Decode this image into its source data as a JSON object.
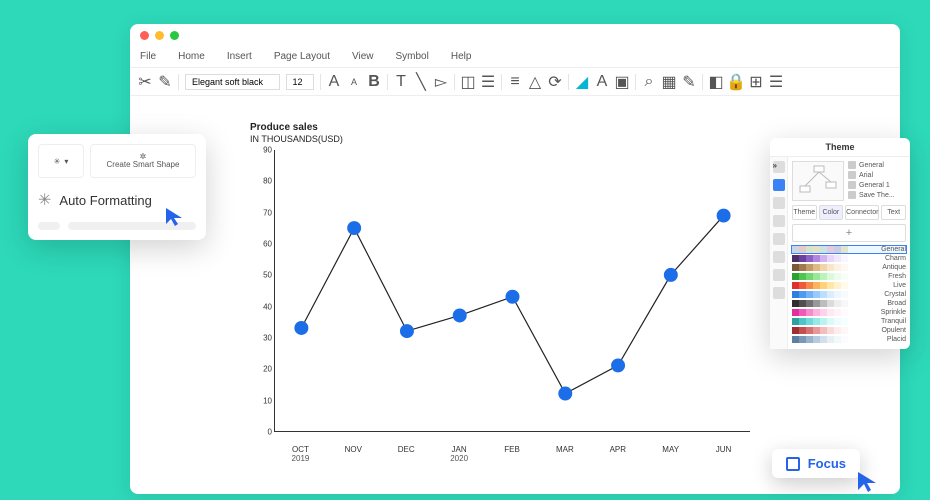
{
  "menubar": [
    "File",
    "Home",
    "Insert",
    "Page Layout",
    "View",
    "Symbol",
    "Help"
  ],
  "toolbar": {
    "font": "Elegant soft black",
    "size": "12"
  },
  "popup": {
    "create_smart_shape": "Create Smart Shape",
    "auto_formatting": "Auto Formatting"
  },
  "theme_panel": {
    "title": "Theme",
    "options": [
      "General",
      "Arial",
      "General 1",
      "Save The..."
    ],
    "tabs": [
      "Theme",
      "Color",
      "Connector",
      "Text"
    ],
    "palettes": [
      "General",
      "Charm",
      "Antique",
      "Fresh",
      "Live",
      "Crystal",
      "Broad",
      "Sprinkle",
      "Tranquil",
      "Opulent",
      "Placid"
    ]
  },
  "focus": {
    "label": "Focus"
  },
  "chart_data": {
    "type": "line",
    "title": "Produce sales",
    "subtitle": "IN THOUSANDS(USD)",
    "ylabel": "",
    "xlabel": "",
    "ylim": [
      0,
      90
    ],
    "yticks": [
      0,
      10,
      20,
      30,
      40,
      50,
      60,
      70,
      80,
      90
    ],
    "categories": [
      "OCT",
      "NOV",
      "DEC",
      "JAN",
      "FEB",
      "MAR",
      "APR",
      "MAY",
      "JUN"
    ],
    "category_years": [
      "2019",
      "",
      "",
      "2020",
      "",
      "",
      "",
      "",
      ""
    ],
    "values": [
      33,
      65,
      32,
      37,
      43,
      12,
      21,
      50,
      69
    ]
  },
  "palette_colors": [
    [
      "#c9d6e5",
      "#e6c9c9",
      "#d6e5c9",
      "#e5e1c9",
      "#c9e5e2",
      "#e5c9e0",
      "#c9cde5",
      "#e0e5c9"
    ],
    [
      "#4a2f68",
      "#6a3fa0",
      "#8e5fc7",
      "#b186e0",
      "#d0b3ef",
      "#e6d6f7",
      "#f1e9fb",
      "#faf5fe"
    ],
    [
      "#7a5a3a",
      "#a07a4e",
      "#c49a66",
      "#e0ba86",
      "#efd5ab",
      "#f6e7cd",
      "#fbf2e4",
      "#fdf9f2"
    ],
    [
      "#2fa02f",
      "#4fc44f",
      "#72d872",
      "#98e898",
      "#bdf2bd",
      "#dbf9db",
      "#eefceE",
      "#f7fef7"
    ],
    [
      "#e02f2f",
      "#ef5a3a",
      "#f78a4a",
      "#fcb35e",
      "#ffd27a",
      "#ffe7a6",
      "#fff3cf",
      "#fffae9"
    ],
    [
      "#2f7fe0",
      "#4f9aef",
      "#72b4f7",
      "#98cbfc",
      "#bddfff",
      "#dbeeff",
      "#eef7ff",
      "#f7fbff"
    ],
    [
      "#2f2f2f",
      "#4f4f4f",
      "#727272",
      "#989898",
      "#bdbdbd",
      "#dbdbdb",
      "#eeeeee",
      "#f7f7f7"
    ],
    [
      "#e02fa0",
      "#ef5ab8",
      "#f78acc",
      "#fcb3de",
      "#ffd2ec",
      "#ffe7f4",
      "#fff3fa",
      "#fffafd"
    ],
    [
      "#2fa0a0",
      "#4fc4c4",
      "#72d8d8",
      "#98e8e8",
      "#bdf2f2",
      "#dbf9f9",
      "#eefcfc",
      "#f7fefe"
    ],
    [
      "#a02f2f",
      "#c44f4f",
      "#d87272",
      "#e89898",
      "#f2bdbd",
      "#f9dbdb",
      "#fceeee",
      "#fef7f7"
    ],
    [
      "#5f7fa0",
      "#7a99b8",
      "#98b3cc",
      "#b6ccde",
      "#d2e0ec",
      "#e7eff5",
      "#f3f8fb",
      "#fafcfe"
    ]
  ]
}
